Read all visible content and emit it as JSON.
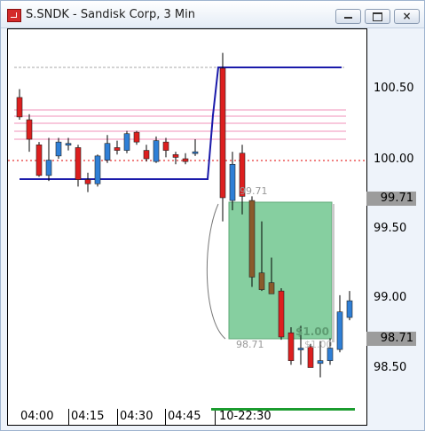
{
  "window": {
    "title": "S.SNDK - Sandisk Corp, 3 Min",
    "controls": {
      "minimize": "minimize",
      "maximize": "maximize",
      "close": "×"
    }
  },
  "chart_data": {
    "type": "candlestick",
    "symbol": "S.SNDK",
    "timeframe": "3 Min",
    "y_ticks": [
      "100.50",
      "100.00",
      "99.50",
      "99.00",
      "98.50"
    ],
    "x_labels": [
      "04:00",
      "04:15",
      "04:30",
      "04:45",
      "10-22:30"
    ],
    "current_price_label": "99.71",
    "target_price_label": "98.71",
    "annotations": {
      "entry": "99.71",
      "exit": "98.71",
      "profit": "$1.00",
      "profit_partial": "$1.00"
    },
    "colors": {
      "up": "#2f7fd6",
      "down": "#dd1f1f",
      "down_later": "#8a5a2b",
      "avg_line": "#1a1aaa",
      "zone": "#86cfa0",
      "pink_levels": "#f4a6c8"
    },
    "candles": [
      {
        "o": 100.44,
        "h": 100.5,
        "l": 100.28,
        "c": 100.3
      },
      {
        "o": 100.28,
        "h": 100.32,
        "l": 100.05,
        "c": 100.14
      },
      {
        "o": 100.1,
        "h": 100.12,
        "l": 99.87,
        "c": 99.88
      },
      {
        "o": 99.88,
        "h": 100.15,
        "l": 99.84,
        "c": 99.99
      },
      {
        "o": 100.02,
        "h": 100.15,
        "l": 100.0,
        "c": 100.12
      },
      {
        "o": 100.1,
        "h": 100.15,
        "l": 100.06,
        "c": 100.11
      },
      {
        "o": 100.08,
        "h": 100.1,
        "l": 99.8,
        "c": 99.85
      },
      {
        "o": 99.85,
        "h": 99.9,
        "l": 99.76,
        "c": 99.82
      },
      {
        "o": 99.82,
        "h": 100.03,
        "l": 99.8,
        "c": 100.02
      },
      {
        "o": 99.99,
        "h": 100.17,
        "l": 99.97,
        "c": 100.11
      },
      {
        "o": 100.08,
        "h": 100.13,
        "l": 100.03,
        "c": 100.06
      },
      {
        "o": 100.06,
        "h": 100.2,
        "l": 100.04,
        "c": 100.18
      },
      {
        "o": 100.19,
        "h": 100.2,
        "l": 100.1,
        "c": 100.12
      },
      {
        "o": 100.06,
        "h": 100.1,
        "l": 99.98,
        "c": 100.0
      },
      {
        "o": 99.98,
        "h": 100.16,
        "l": 99.97,
        "c": 100.13
      },
      {
        "o": 100.12,
        "h": 100.15,
        "l": 100.01,
        "c": 100.06
      },
      {
        "o": 100.03,
        "h": 100.05,
        "l": 99.96,
        "c": 100.01
      },
      {
        "o": 100.0,
        "h": 100.04,
        "l": 99.96,
        "c": 99.98
      },
      {
        "o": 100.04,
        "h": 100.14,
        "l": 100.02,
        "c": 100.05
      },
      {
        "o": 100.65,
        "h": 100.76,
        "l": 99.55,
        "c": 99.72
      },
      {
        "o": 99.7,
        "h": 100.05,
        "l": 99.63,
        "c": 99.96
      },
      {
        "o": 100.04,
        "h": 100.1,
        "l": 99.6,
        "c": 99.73
      },
      {
        "o": 99.7,
        "h": 99.73,
        "l": 99.08,
        "c": 99.15
      },
      {
        "o": 99.18,
        "h": 99.55,
        "l": 99.05,
        "c": 99.06
      },
      {
        "o": 99.11,
        "h": 99.29,
        "l": 99.03,
        "c": 99.03
      },
      {
        "o": 99.05,
        "h": 99.07,
        "l": 98.7,
        "c": 98.72
      },
      {
        "o": 98.75,
        "h": 98.79,
        "l": 98.52,
        "c": 98.55
      },
      {
        "o": 98.64,
        "h": 98.8,
        "l": 98.52,
        "c": 98.64
      },
      {
        "o": 98.65,
        "h": 98.67,
        "l": 98.5,
        "c": 98.5
      },
      {
        "o": 98.53,
        "h": 98.69,
        "l": 98.43,
        "c": 98.55
      },
      {
        "o": 98.55,
        "h": 98.71,
        "l": 98.52,
        "c": 98.64
      },
      {
        "o": 98.63,
        "h": 99.02,
        "l": 98.61,
        "c": 98.9
      },
      {
        "o": 98.86,
        "h": 99.05,
        "l": 98.84,
        "c": 98.98
      }
    ]
  }
}
